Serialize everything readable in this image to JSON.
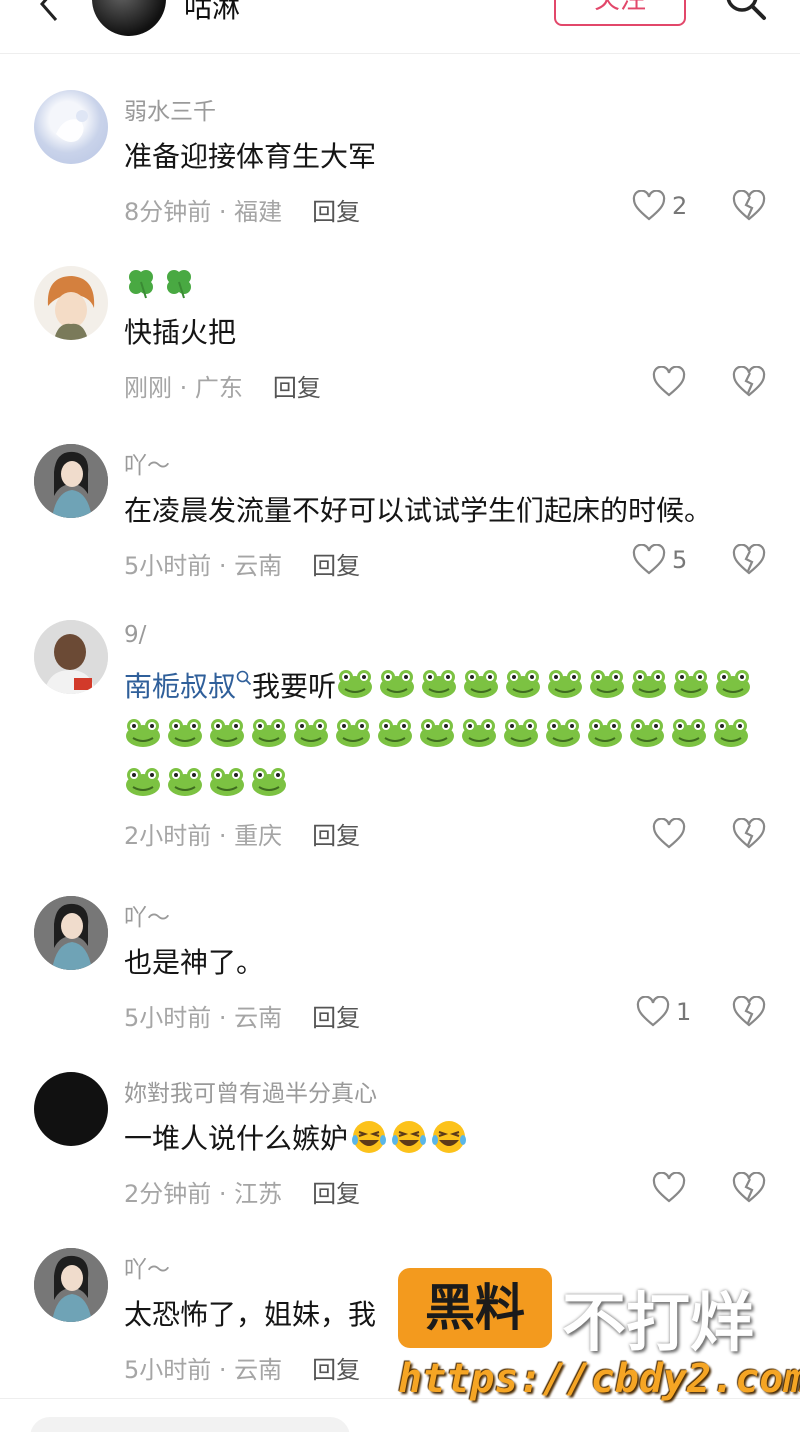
{
  "header": {
    "title": "咕淋",
    "follow_label": "关注"
  },
  "comments": [
    {
      "username": "弱水三千",
      "text": "准备迎接体育生大军",
      "time": "8分钟前",
      "location": "福建",
      "reply_label": "回复",
      "likes": "2"
    },
    {
      "username": "🍀🍀",
      "text": "快插火把",
      "time": "刚刚",
      "location": "广东",
      "reply_label": "回复",
      "likes": ""
    },
    {
      "username": "吖～",
      "text": "在凌晨发流量不好可以试试学生们起床的时候。",
      "time": "5小时前",
      "location": "云南",
      "reply_label": "回复",
      "likes": "5"
    },
    {
      "username": "9/",
      "mention": "南栀叔叔",
      "text": "我要听",
      "frog_count": 29,
      "time": "2小时前",
      "location": "重庆",
      "reply_label": "回复",
      "likes": ""
    },
    {
      "username": "吖～",
      "text": "也是神了。",
      "time": "5小时前",
      "location": "云南",
      "reply_label": "回复",
      "likes": "1"
    },
    {
      "username": "妳對我可曾有過半分真心",
      "text": "一堆人说什么嫉妒",
      "laugh_count": 3,
      "time": "2分钟前",
      "location": "江苏",
      "reply_label": "回复",
      "likes": ""
    },
    {
      "username": "吖～",
      "text": "太恐怖了，姐妹，我",
      "time": "5小时前",
      "location": "云南",
      "reply_label": "回复",
      "likes": ""
    }
  ],
  "watermark": {
    "badge": "黑料",
    "slogan": "不打烊",
    "url": "https://cbdy2.com"
  },
  "colors": {
    "accent": "#e2476a",
    "mention": "#2f5f9a",
    "meta": "#a5a5a5",
    "watermark_orange": "#f39a1e"
  },
  "icons": [
    "back-icon",
    "search-icon",
    "heart-icon",
    "broken-heart-icon",
    "frog-emoji",
    "laughing-emoji",
    "clover-emoji"
  ]
}
